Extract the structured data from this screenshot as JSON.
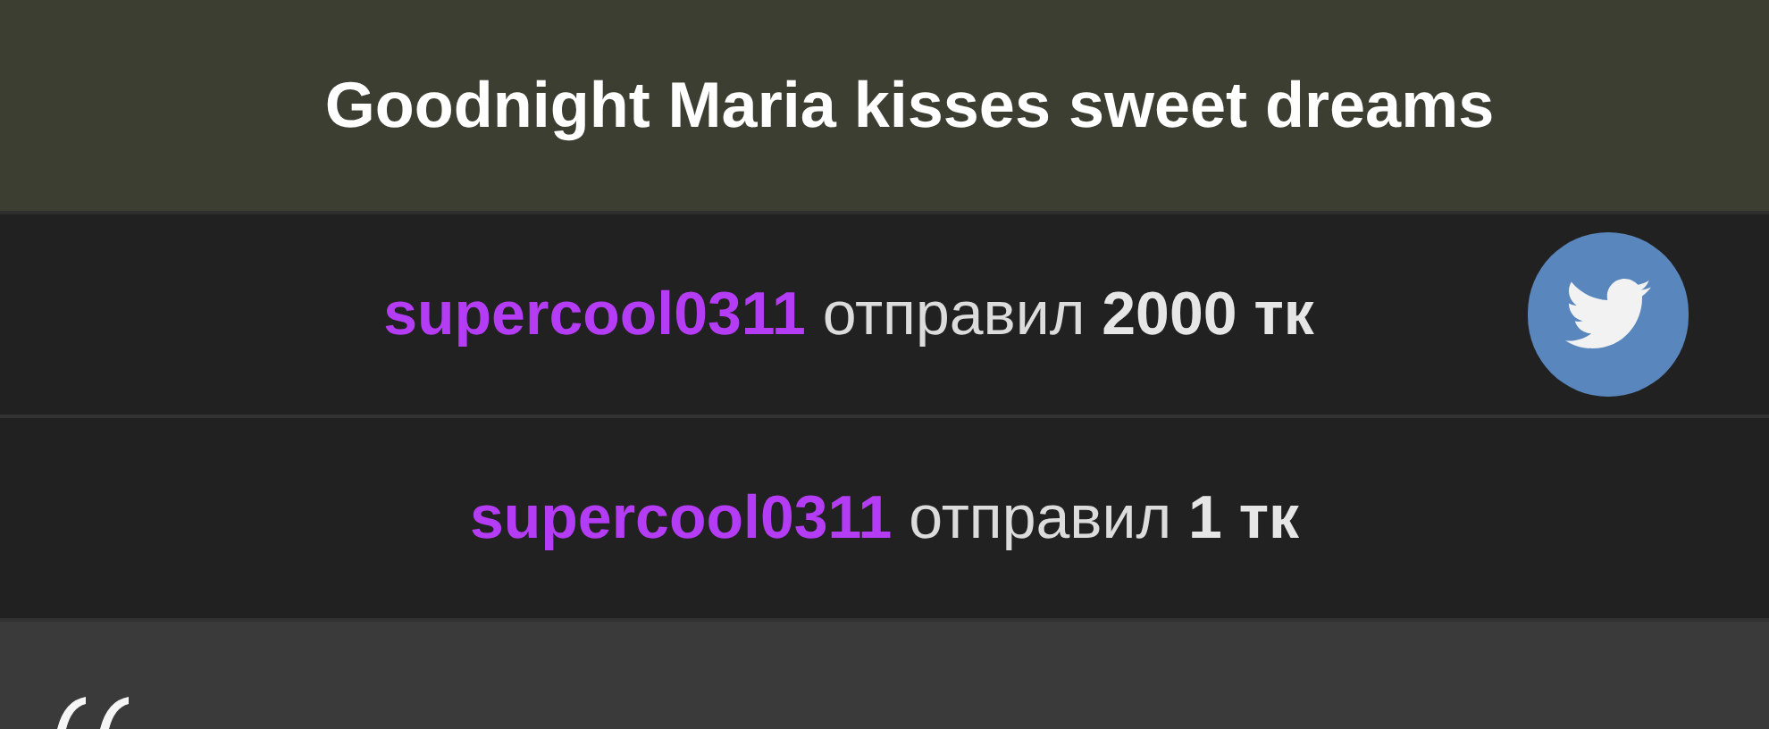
{
  "title": "Goodnight Maria kisses sweet dreams",
  "donations": [
    {
      "user": "supercool0311",
      "verb": "отправил",
      "amount": "2000 тк",
      "share_button": true
    },
    {
      "user": "supercool0311",
      "verb": "отправил",
      "amount": "1 тк",
      "share_button": false
    }
  ]
}
